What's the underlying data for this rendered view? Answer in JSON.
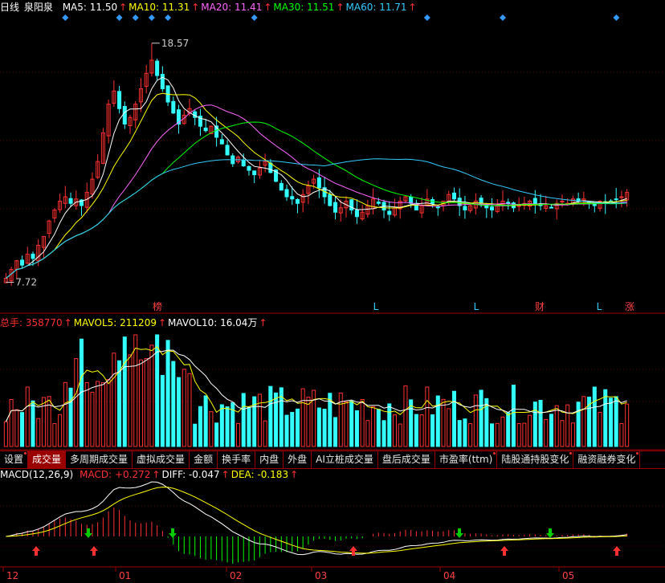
{
  "header": {
    "period": "日线",
    "stock": "泉阳泉",
    "ma": [
      {
        "label": "MA5:",
        "value": "11.50",
        "color": "#ffffff"
      },
      {
        "label": "MA10:",
        "value": "11.31",
        "color": "#ffff00"
      },
      {
        "label": "MA20:",
        "value": "11.41",
        "color": "#ff66ff"
      },
      {
        "label": "MA30:",
        "value": "11.51",
        "color": "#00ff00"
      },
      {
        "label": "MA60:",
        "value": "11.71",
        "color": "#33ccff"
      }
    ]
  },
  "price_annotations": {
    "high": "18.57",
    "low": "7.72"
  },
  "event_markers": [
    {
      "text": "榜",
      "color": "#ff4040"
    },
    {
      "text": "L",
      "color": "#33ccff"
    },
    {
      "text": "L",
      "color": "#33ccff"
    },
    {
      "text": "财",
      "color": "#ff4040"
    },
    {
      "text": "L",
      "color": "#33ccff"
    },
    {
      "text": "涨",
      "color": "#ff4040"
    }
  ],
  "volume_header": [
    {
      "label": "总手:",
      "value": "358770",
      "color": "#ff3030"
    },
    {
      "label": "MAVOL5:",
      "value": "211209",
      "color": "#ffff00"
    },
    {
      "label": "MAVOL10:",
      "value": "16.04万",
      "color": "#ffffff"
    }
  ],
  "tabs": [
    {
      "label": "设置",
      "dot": true,
      "active": false
    },
    {
      "label": "成交量",
      "dot": false,
      "active": true
    },
    {
      "label": "多周期成交量",
      "dot": false,
      "active": false
    },
    {
      "label": "虚拟成交量",
      "dot": false,
      "active": false
    },
    {
      "label": "金额",
      "dot": false,
      "active": false
    },
    {
      "label": "换手率",
      "dot": false,
      "active": false
    },
    {
      "label": "内盘",
      "dot": false,
      "active": false
    },
    {
      "label": "外盘",
      "dot": false,
      "active": false
    },
    {
      "label": "AI立桩成交量",
      "dot": false,
      "active": false
    },
    {
      "label": "盘后成交量",
      "dot": false,
      "active": false
    },
    {
      "label": "市盈率(ttm)",
      "dot": true,
      "active": false
    },
    {
      "label": "陆股通持股变化",
      "dot": true,
      "active": false
    },
    {
      "label": "融资融券变化",
      "dot": true,
      "active": false
    }
  ],
  "macd_header": [
    {
      "label": "MACD(12,26,9)",
      "value": "",
      "color": "#ffffff"
    },
    {
      "label": "MACD:",
      "value": "+0.272",
      "color": "#ff3030"
    },
    {
      "label": "DIFF:",
      "value": "-0.047",
      "color": "#ffffff"
    },
    {
      "label": "DEA:",
      "value": "-0.183",
      "color": "#ffff00"
    }
  ],
  "x_axis_ticks": [
    "12",
    "01",
    "02",
    "03",
    "04",
    "05"
  ],
  "chart_data": {
    "type": "candlestick",
    "period": "daily",
    "x_ticks": [
      "12",
      "01",
      "02",
      "03",
      "04",
      "05"
    ],
    "price": {
      "high": 18.57,
      "low": 7.72,
      "ylim": [
        6.5,
        19.8
      ]
    },
    "closes": [
      7.9,
      8.3,
      8.7,
      8.5,
      9.0,
      8.8,
      9.4,
      9.8,
      10.5,
      11.0,
      11.4,
      11.6,
      11.3,
      11.5,
      11.2,
      11.8,
      12.4,
      13.2,
      14.5,
      15.8,
      16.4,
      15.6,
      14.9,
      15.2,
      15.8,
      16.5,
      17.2,
      17.8,
      17.1,
      16.5,
      15.9,
      15.4,
      14.9,
      15.3,
      15.6,
      15.2,
      14.8,
      14.6,
      14.8,
      14.3,
      14.0,
      13.5,
      13.1,
      13.4,
      13.0,
      12.8,
      12.6,
      12.9,
      13.2,
      12.7,
      12.3,
      11.9,
      11.6,
      11.5,
      11.3,
      11.7,
      12.1,
      12.4,
      12.0,
      11.6,
      11.2,
      10.9,
      11.1,
      11.4,
      11.0,
      10.7,
      10.9,
      11.2,
      11.5,
      11.3,
      11.0,
      10.8,
      11.1,
      11.4,
      11.6,
      11.3,
      11.0,
      11.2,
      11.5,
      11.3,
      11.1,
      11.4,
      11.7,
      11.5,
      11.2,
      11.0,
      11.2,
      11.4,
      11.3,
      11.1,
      11.0,
      11.2,
      11.4,
      11.3,
      11.1,
      11.2,
      11.3,
      11.4,
      11.3,
      11.2,
      11.2,
      11.1,
      11.3,
      11.4,
      11.3,
      11.5,
      11.4,
      11.5,
      11.3,
      11.2,
      11.4,
      11.3,
      11.4,
      11.5,
      11.6,
      11.8
    ],
    "volume": {
      "total": 358770,
      "mavol5": 211209,
      "mavol10": 160400
    },
    "macd": {
      "params": [
        12,
        26,
        9
      ],
      "macd": 0.272,
      "diff": -0.047,
      "dea": -0.183
    }
  }
}
